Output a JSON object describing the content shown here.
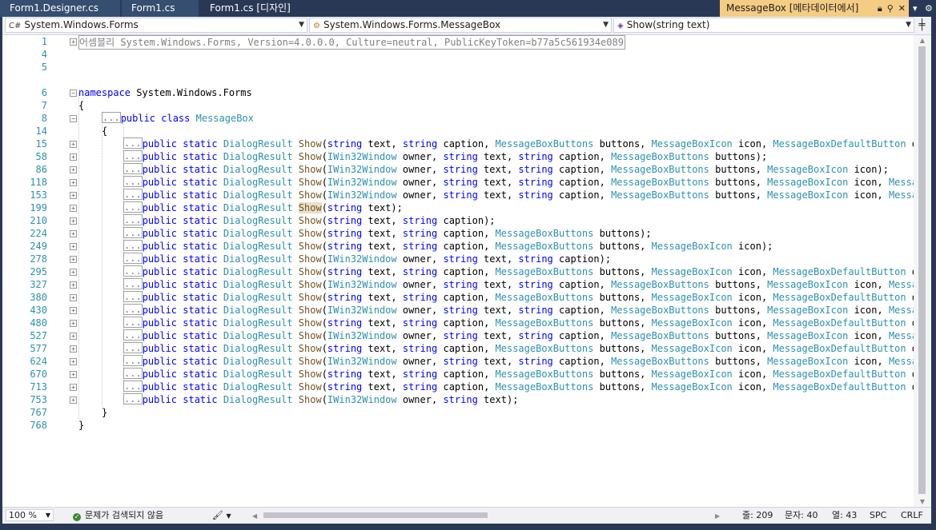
{
  "tabs": [
    {
      "label": "Form1.Designer.cs"
    },
    {
      "label": "Form1.cs"
    },
    {
      "label": "Form1.cs [디자인]"
    }
  ],
  "active_tab": {
    "label": "MessageBox [메타데이터에서]"
  },
  "tab_overflow": "▾",
  "settings_glyph": "⚙",
  "nav": {
    "project": "System.Windows.Forms",
    "type": "System.Windows.Forms.MessageBox",
    "member": "Show(string text)"
  },
  "code": {
    "assembly_line": {
      "number": "1",
      "text": "어셈블리 System.Windows.Forms, Version=4.0.0.0, Culture=neutral, PublicKeyToken=b77a5c561934e089"
    },
    "blank_numbers": [
      "4",
      "5"
    ],
    "namespace_line": {
      "number": "6",
      "keyword": "namespace",
      "name": "System.Windows.Forms"
    },
    "ns_open": {
      "number": "7",
      "text": "{"
    },
    "class_line": {
      "number": "8",
      "dots": "...",
      "keywords": "public class",
      "name": "MessageBox"
    },
    "class_open": {
      "number": "14",
      "text": "{"
    },
    "methods": [
      {
        "number": "15",
        "params": "string text, string caption, MessageBoxButtons buttons, MessageBoxIcon icon, MessageBoxDefaultButton defau"
      },
      {
        "number": "58",
        "params": "IWin32Window owner, string text, string caption, MessageBoxButtons buttons);"
      },
      {
        "number": "86",
        "params": "IWin32Window owner, string text, string caption, MessageBoxButtons buttons, MessageBoxIcon icon);"
      },
      {
        "number": "118",
        "params": "IWin32Window owner, string text, string caption, MessageBoxButtons buttons, MessageBoxIcon icon, MessageBo"
      },
      {
        "number": "153",
        "params": "IWin32Window owner, string text, string caption, MessageBoxButtons buttons, MessageBoxIcon icon, MessageBo"
      },
      {
        "number": "199",
        "params": "string text);",
        "highlight": true
      },
      {
        "number": "210",
        "params": "string text, string caption);"
      },
      {
        "number": "224",
        "params": "string text, string caption, MessageBoxButtons buttons);"
      },
      {
        "number": "249",
        "params": "string text, string caption, MessageBoxButtons buttons, MessageBoxIcon icon);"
      },
      {
        "number": "278",
        "params": "IWin32Window owner, string text, string caption);"
      },
      {
        "number": "295",
        "params": "string text, string caption, MessageBoxButtons buttons, MessageBoxIcon icon, MessageBoxDefaultButton defau"
      },
      {
        "number": "327",
        "params": "IWin32Window owner, string text, string caption, MessageBoxButtons buttons, MessageBoxIcon icon, MessageBo"
      },
      {
        "number": "380",
        "params": "string text, string caption, MessageBoxButtons buttons, MessageBoxIcon icon, MessageBoxDefaultButton defau"
      },
      {
        "number": "430",
        "params": "IWin32Window owner, string text, string caption, MessageBoxButtons buttons, MessageBoxIcon icon, MessageBo"
      },
      {
        "number": "480",
        "params": "string text, string caption, MessageBoxButtons buttons, MessageBoxIcon icon, MessageBoxDefaultButton defau"
      },
      {
        "number": "527",
        "params": "IWin32Window owner, string text, string caption, MessageBoxButtons buttons, MessageBoxIcon icon, MessageBo"
      },
      {
        "number": "577",
        "params": "string text, string caption, MessageBoxButtons buttons, MessageBoxIcon icon, MessageBoxDefaultButton defau"
      },
      {
        "number": "624",
        "params": "IWin32Window owner, string text, string caption, MessageBoxButtons buttons, MessageBoxIcon icon, MessageBo"
      },
      {
        "number": "670",
        "params": "string text, string caption, MessageBoxButtons buttons, MessageBoxIcon icon, MessageBoxDefaultButton defau"
      },
      {
        "number": "713",
        "params": "string text, string caption, MessageBoxButtons buttons, MessageBoxIcon icon, MessageBoxDefaultButton defau"
      },
      {
        "number": "753",
        "params": "IWin32Window owner, string text);"
      }
    ],
    "method_dots": "...",
    "method_prefix_kw": "public static",
    "method_return": "DialogResult",
    "method_name": "Show",
    "class_close": {
      "number": "767",
      "text": "}"
    },
    "ns_close": {
      "number": "768",
      "text": "}"
    }
  },
  "keywords": [
    "namespace",
    "public",
    "class",
    "static",
    "string"
  ],
  "types": [
    "MessageBox",
    "DialogResult",
    "IWin32Window",
    "MessageBoxButtons",
    "MessageBoxIcon",
    "MessageBoxDefaultButton",
    "MessageBo"
  ],
  "status": {
    "zoom": "100 %",
    "issues": "문제가 검색되지 않음",
    "line": "줄: 209",
    "char": "문자: 40",
    "col": "열: 43",
    "spacing": "SPC",
    "eol": "CRLF"
  },
  "colors": {
    "keyword": "#0000ff",
    "type": "#2b91af",
    "method": "#74531f",
    "line_number": "#2b91af",
    "active_tab": "#f5cc84",
    "chrome": "#293955"
  }
}
